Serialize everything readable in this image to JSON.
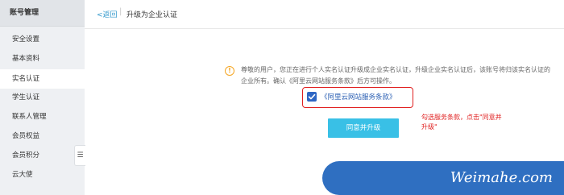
{
  "sidebar": {
    "title": "账号管理",
    "items": [
      {
        "label": "安全设置"
      },
      {
        "label": "基本资料"
      },
      {
        "label": "实名认证"
      },
      {
        "label": "学生认证"
      },
      {
        "label": "联系人管理"
      },
      {
        "label": "会员权益"
      },
      {
        "label": "会员积分"
      },
      {
        "label": "云大使"
      }
    ],
    "collapse_icon": "menu-collapse-icon"
  },
  "header": {
    "back_label": "<返回",
    "separator": "|",
    "page_title": "升级为企业认证"
  },
  "notice": {
    "icon": "warning-icon",
    "icon_glyph": "!",
    "text": "尊敬的用户，您正在进行个人实名认证升级成企业实名认证，升级企业实名认证后，该账号将归该实名认证的企业所有。确认《阿里云网站服务条款》后方可操作。"
  },
  "agreement": {
    "checked": true,
    "label": "《阿里云网站服务条款》"
  },
  "hint": {
    "text": "勾选服务条款，点击\"同意并升级\""
  },
  "actions": {
    "agree_button": "同意并升级"
  },
  "watermark": {
    "text": "Weimahe.com"
  },
  "colors": {
    "accent": "#39c0e6",
    "link": "#2b5fb3",
    "highlight": "#e02020",
    "warning": "#f5a623"
  }
}
